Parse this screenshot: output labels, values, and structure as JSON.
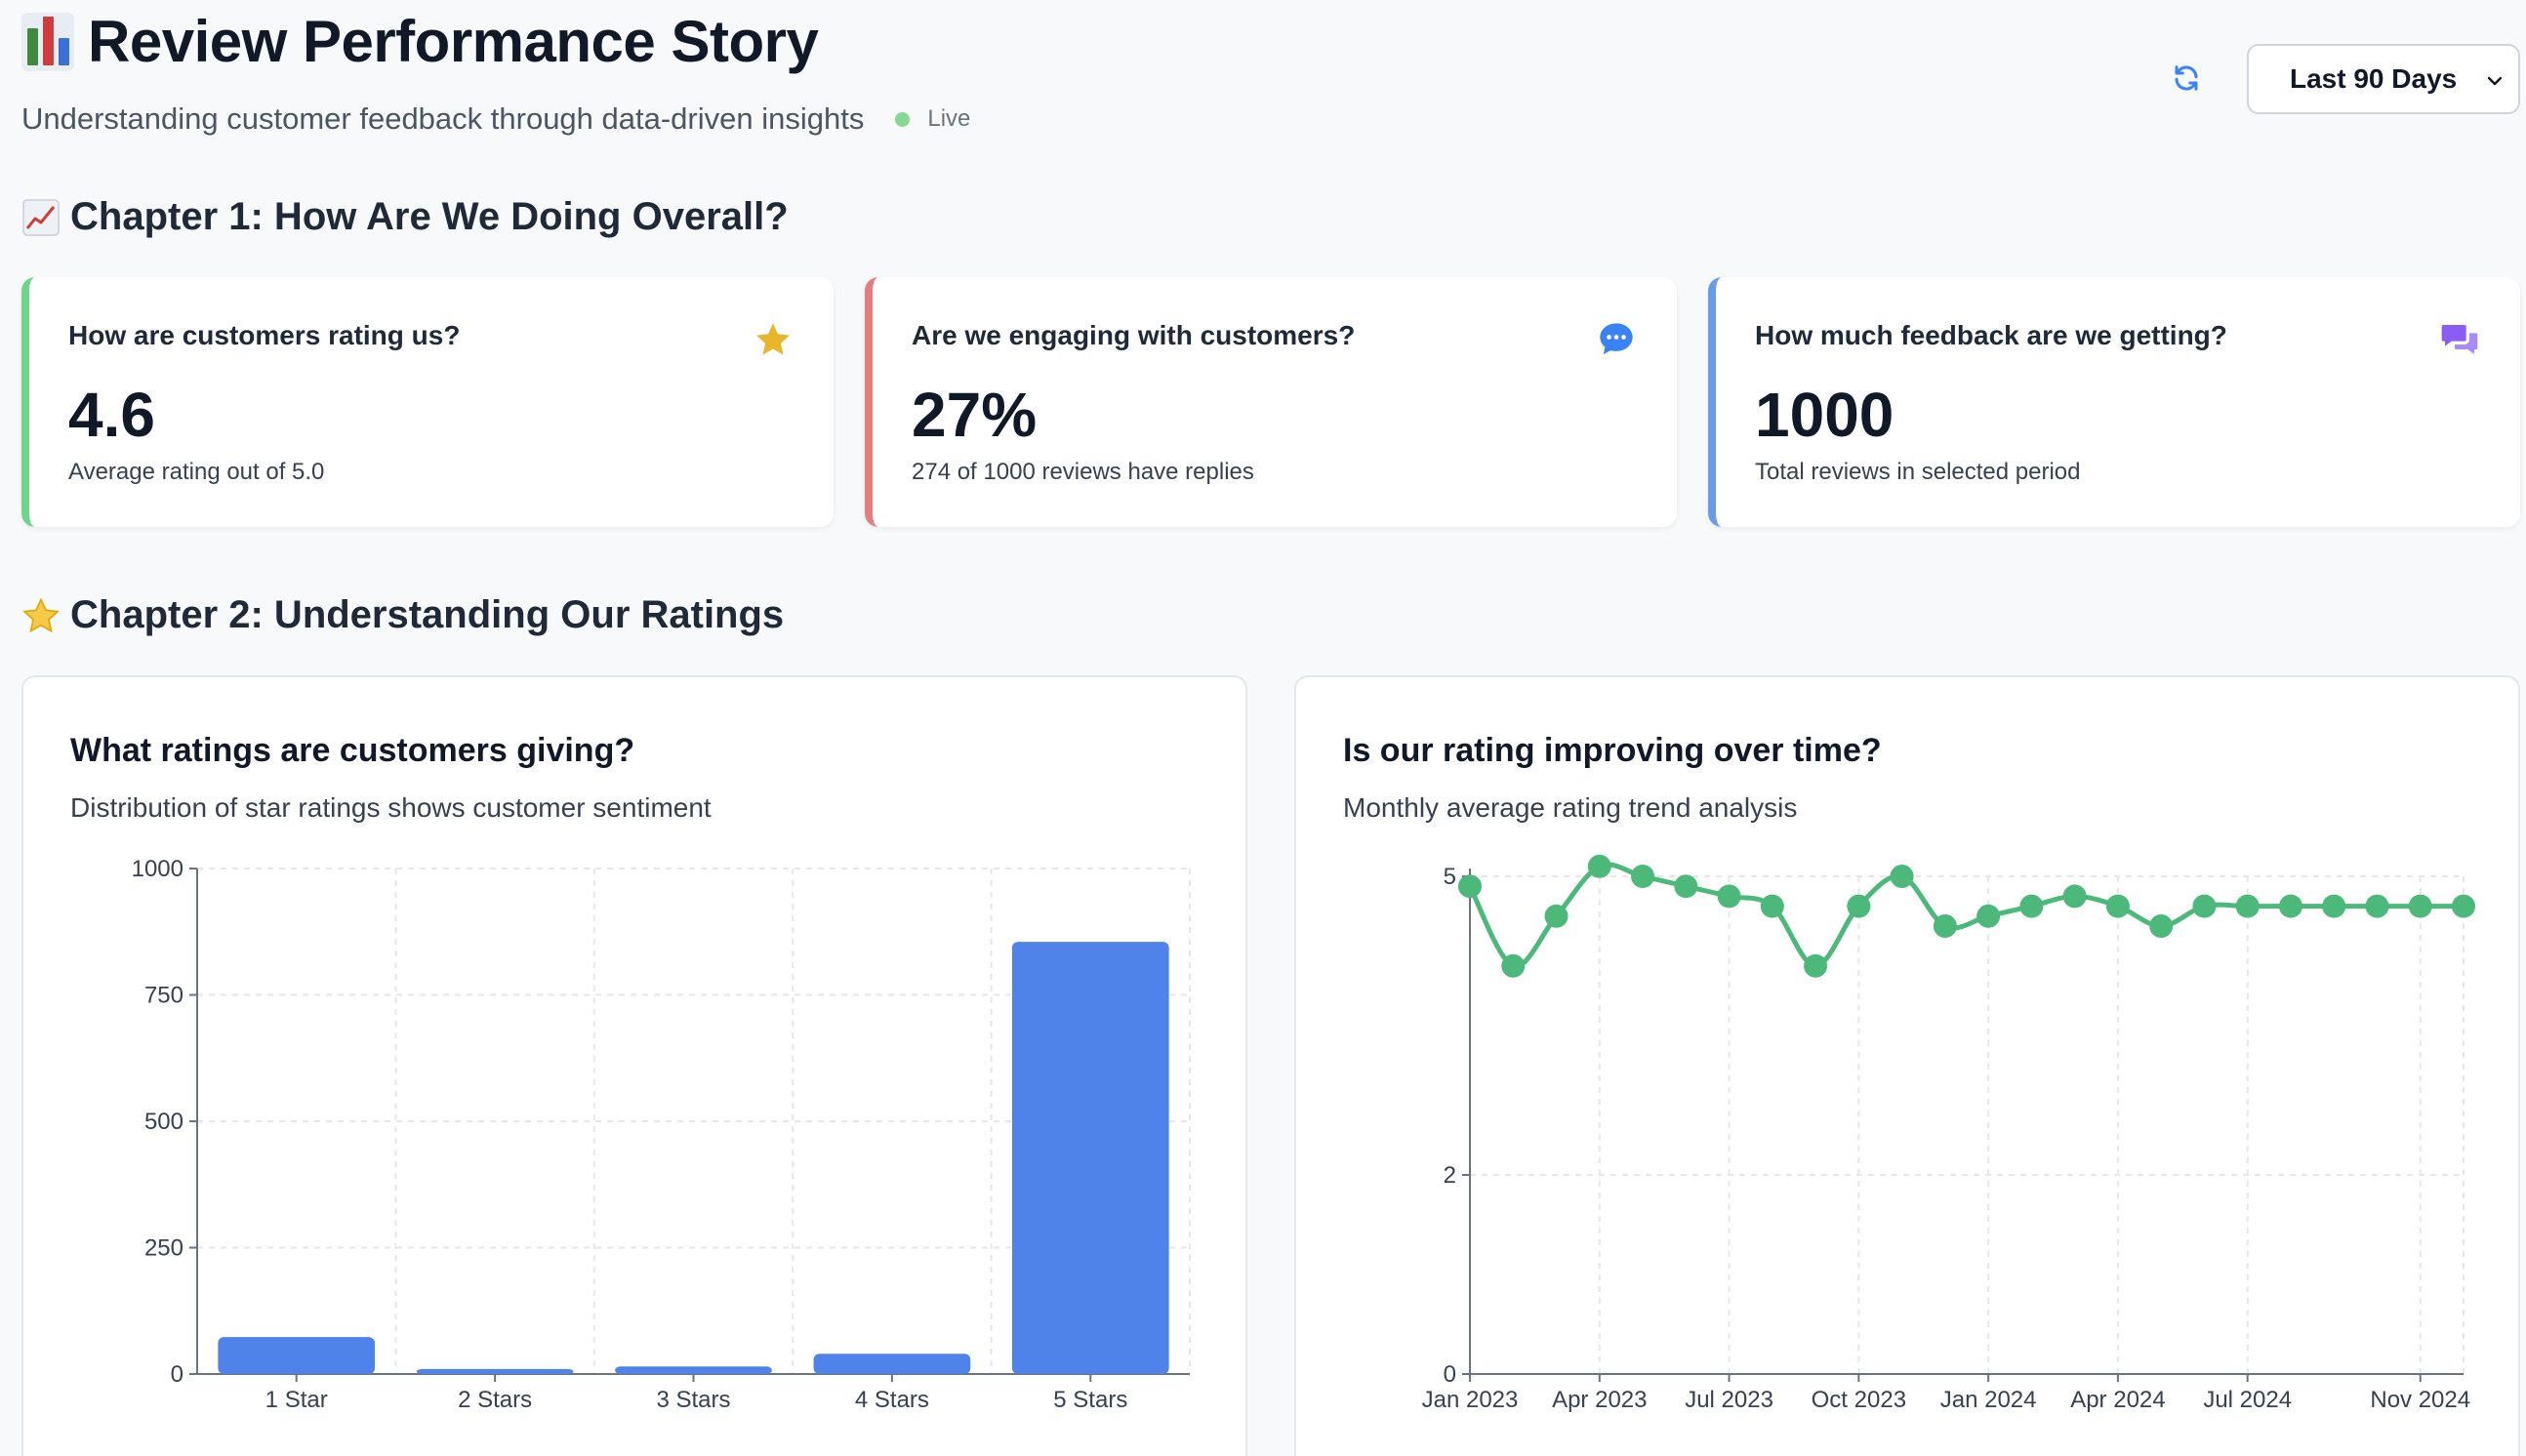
{
  "header": {
    "title": "Review Performance Story",
    "subtitle": "Understanding customer feedback through data-driven insights",
    "live_label": "Live",
    "period_select": "Last 90 Days"
  },
  "chapters": {
    "ch1": "Chapter 1: How Are We Doing Overall?",
    "ch2": "Chapter 2: Understanding Our Ratings"
  },
  "kpis": [
    {
      "question": "How are customers rating us?",
      "value": "4.6",
      "desc": "Average rating out of 5.0",
      "accent": "#6dd68a",
      "icon": "star-icon"
    },
    {
      "question": "Are we engaging with customers?",
      "value": "27%",
      "desc": "274 of 1000 reviews have replies",
      "accent": "#e47d7d",
      "icon": "chat-bubble-icon"
    },
    {
      "question": "How much feedback are we getting?",
      "value": "1000",
      "desc": "Total reviews in selected period",
      "accent": "#6a9be6",
      "icon": "comments-icon"
    }
  ],
  "charts": {
    "distribution": {
      "title": "What ratings are customers giving?",
      "subtitle": "Distribution of star ratings shows customer sentiment"
    },
    "trend": {
      "title": "Is our rating improving over time?",
      "subtitle": "Monthly average rating trend analysis"
    }
  },
  "chart_data": [
    {
      "type": "bar",
      "categories": [
        "1 Star",
        "2 Stars",
        "3 Stars",
        "4 Stars",
        "5 Stars"
      ],
      "values": [
        73,
        10,
        15,
        40,
        855
      ],
      "yticks": [
        0,
        250,
        500,
        750,
        1000
      ],
      "ylim": [
        0,
        1000
      ],
      "color": "#4f83ea",
      "grid": true
    },
    {
      "type": "line",
      "x": [
        "Jan 2023",
        "Feb 2023",
        "Mar 2023",
        "Apr 2023",
        "May 2023",
        "Jun 2023",
        "Jul 2023",
        "Aug 2023",
        "Sep 2023",
        "Oct 2023",
        "Nov 2023",
        "Dec 2023",
        "Jan 2024",
        "Feb 2024",
        "Mar 2024",
        "Apr 2024",
        "May 2024",
        "Jun 2024",
        "Jul 2024",
        "Aug 2024",
        "Sep 2024",
        "Oct 2024",
        "Nov 2024",
        "Dec 2024"
      ],
      "values": [
        4.9,
        4.1,
        4.6,
        5.1,
        5.0,
        4.9,
        4.8,
        4.7,
        4.1,
        4.7,
        5.0,
        4.5,
        4.6,
        4.7,
        4.8,
        4.7,
        4.5,
        4.7,
        4.7,
        4.7,
        4.7,
        4.7,
        4.7,
        4.7
      ],
      "xticks": [
        "Jan 2023",
        "Apr 2023",
        "Jul 2023",
        "Oct 2023",
        "Jan 2024",
        "Apr 2024",
        "Jul 2024",
        "Nov 2024"
      ],
      "yticks": [
        0,
        2,
        5
      ],
      "ylim": [
        0,
        5
      ],
      "color": "#4cb87a",
      "grid": true
    }
  ]
}
